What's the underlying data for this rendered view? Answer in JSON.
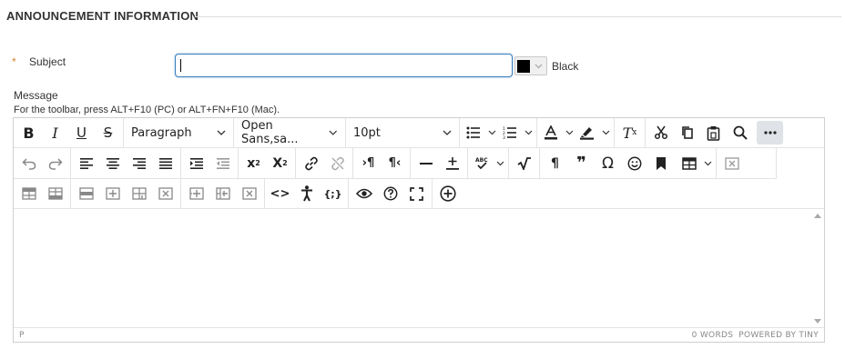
{
  "section": {
    "title": "ANNOUNCEMENT INFORMATION"
  },
  "subject": {
    "required_mark": "*",
    "label": "Subject",
    "value": ""
  },
  "color": {
    "swatch": "#000000",
    "label": "Black"
  },
  "message": {
    "label": "Message",
    "hint": "For the toolbar, press ALT+F10 (PC) or ALT+FN+F10 (Mac)."
  },
  "toolbar": {
    "block_format": "Paragraph",
    "font_family": "Open Sans,sa...",
    "font_size": "10pt",
    "row1_icons": [
      "bold-icon",
      "italic-icon",
      "underline-icon",
      "strikethrough-icon",
      "bullet-list-icon",
      "numbered-list-icon",
      "text-color-icon",
      "highlight-icon",
      "clear-format-icon",
      "cut-icon",
      "copy-icon",
      "paste-icon",
      "search-icon",
      "more-icon"
    ],
    "row2_icons": [
      "undo-icon",
      "redo-icon",
      "align-left-icon",
      "align-center-icon",
      "align-right-icon",
      "align-justify-icon",
      "indent-icon",
      "outdent-icon",
      "superscript-icon",
      "subscript-icon",
      "link-icon",
      "unlink-icon",
      "ltr-icon",
      "rtl-icon",
      "horizontal-rule-icon",
      "plus-minus-icon",
      "spellcheck-icon",
      "math-icon",
      "paragraph-mark-icon",
      "quote-icon",
      "omega-icon",
      "emoji-icon",
      "bookmark-icon",
      "table-icon",
      "delete-table-icon"
    ],
    "row3_icons": [
      "row-before-icon",
      "row-after-icon",
      "delete-row-icon",
      "col-before-icon",
      "col-after-icon",
      "delete-col-icon",
      "insert-col-icon",
      "merge-cells-icon",
      "split-cells-icon",
      "code-icon",
      "accessibility-icon",
      "source-code-icon",
      "preview-icon",
      "help-icon",
      "fullscreen-icon",
      "add-content-icon"
    ]
  },
  "statusbar": {
    "path": "P",
    "word_count": "0 WORDS",
    "powered_by": "POWERED BY TINY"
  }
}
